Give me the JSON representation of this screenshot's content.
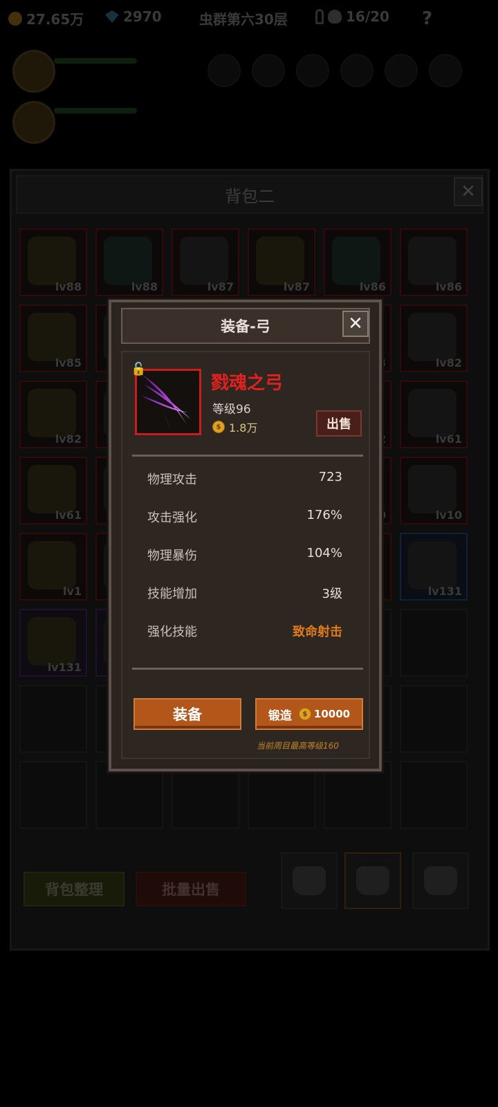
{
  "topbar": {
    "gold": "27.65万",
    "gems": "2970",
    "stage": "虫群第六30层",
    "kills": "16/20",
    "help": "?"
  },
  "backpack": {
    "title": "背包二",
    "close": "✕",
    "slots": [
      {
        "lv": "lv88",
        "tier": "red"
      },
      {
        "lv": "lv88",
        "tier": "red"
      },
      {
        "lv": "lv87",
        "tier": "red"
      },
      {
        "lv": "lv87",
        "tier": "red"
      },
      {
        "lv": "lv86",
        "tier": "red"
      },
      {
        "lv": "lv86",
        "tier": "red"
      },
      {
        "lv": "lv85",
        "tier": "red"
      },
      {
        "lv": "",
        "tier": "red"
      },
      {
        "lv": "",
        "tier": "red"
      },
      {
        "lv": "",
        "tier": "red"
      },
      {
        "lv": "3",
        "tier": "red"
      },
      {
        "lv": "lv82",
        "tier": "red"
      },
      {
        "lv": "lv82",
        "tier": "red"
      },
      {
        "lv": "",
        "tier": "red"
      },
      {
        "lv": "",
        "tier": "red"
      },
      {
        "lv": "",
        "tier": "red"
      },
      {
        "lv": "2",
        "tier": "red"
      },
      {
        "lv": "lv61",
        "tier": "red"
      },
      {
        "lv": "lv61",
        "tier": "red"
      },
      {
        "lv": "",
        "tier": "red"
      },
      {
        "lv": "",
        "tier": "red"
      },
      {
        "lv": "",
        "tier": "red"
      },
      {
        "lv": "0",
        "tier": "red"
      },
      {
        "lv": "lv10",
        "tier": "red"
      },
      {
        "lv": "lv1",
        "tier": "red"
      },
      {
        "lv": "",
        "tier": "red"
      },
      {
        "lv": "",
        "tier": "red"
      },
      {
        "lv": "",
        "tier": "red"
      },
      {
        "lv": "",
        "tier": "red"
      },
      {
        "lv": "lv131",
        "tier": "blue"
      },
      {
        "lv": "lv131",
        "tier": "purple"
      },
      {
        "lv": "",
        "tier": "purple"
      },
      {
        "lv": "",
        "tier": ""
      },
      {
        "lv": "",
        "tier": ""
      },
      {
        "lv": "",
        "tier": ""
      },
      {
        "lv": "",
        "tier": ""
      },
      {
        "lv": "",
        "tier": ""
      },
      {
        "lv": "",
        "tier": ""
      },
      {
        "lv": "",
        "tier": ""
      },
      {
        "lv": "",
        "tier": ""
      },
      {
        "lv": "",
        "tier": ""
      },
      {
        "lv": "",
        "tier": ""
      },
      {
        "lv": "",
        "tier": ""
      },
      {
        "lv": "",
        "tier": ""
      },
      {
        "lv": "",
        "tier": ""
      },
      {
        "lv": "",
        "tier": ""
      },
      {
        "lv": "",
        "tier": ""
      },
      {
        "lv": "",
        "tier": ""
      }
    ],
    "sort_label": "背包整理",
    "bulk_sell_label": "批量出售"
  },
  "dialog": {
    "title": "装备-弓",
    "close": "✕",
    "item": {
      "name": "戮魂之弓",
      "level": "等级96",
      "price": "1.8万",
      "coin_symbol": "$"
    },
    "sell_label": "出售",
    "stats": [
      {
        "label": "物理攻击",
        "value": "723"
      },
      {
        "label": "攻击强化",
        "value": "176%"
      },
      {
        "label": "物理暴伤",
        "value": "104%"
      },
      {
        "label": "技能增加",
        "value": "3级"
      },
      {
        "label": "强化技能",
        "value": "致命射击"
      }
    ],
    "equip_label": "装备",
    "forge_label": "锻造",
    "forge_cost": "10000",
    "hint": "当前周目最高等级160"
  },
  "colors": {
    "accent_orange": "#b2561a",
    "item_name_red": "#e0221f",
    "skill_orange": "#e07a1a",
    "rare_red_border": "#cc1c1c"
  }
}
